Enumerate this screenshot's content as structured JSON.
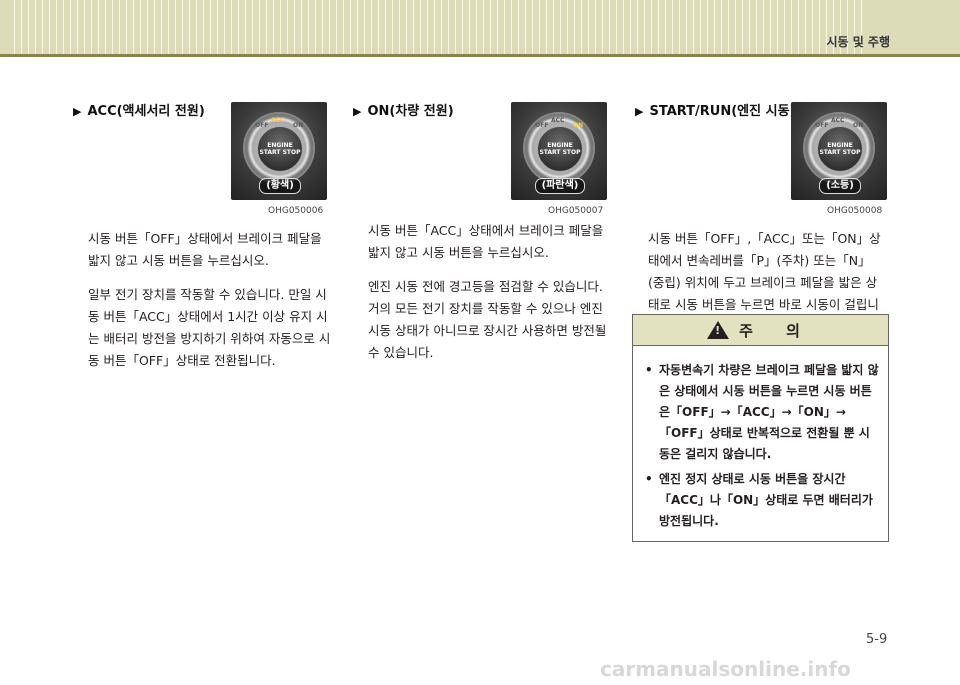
{
  "header": {
    "title": "시동 및 주행"
  },
  "sections": [
    {
      "heading": "ACC(액세서리 전원)",
      "image": {
        "button_text": "ENGINE START STOP",
        "color_tag": "(황색)",
        "code": "OHG050006",
        "lit": "ACC"
      },
      "paragraphs": [
        "시동 버튼「OFF」상태에서 브레이크 페달을 밟지 않고 시동 버튼을 누르십시오.",
        "일부 전기 장치를 작동할 수 있습니다. 만일 시동 버튼「ACC」상태에서 1시간 이상 유지 시는 배터리 방전을 방지하기 위하여 자동으로 시동 버튼「OFF」상태로 전환됩니다."
      ]
    },
    {
      "heading": "ON(차량 전원)",
      "image": {
        "button_text": "ENGINE START STOP",
        "color_tag": "(파란색)",
        "code": "OHG050007",
        "lit": "ON"
      },
      "paragraphs": [
        "시동 버튼「ACC」상태에서 브레이크 페달을 밟지 않고 시동 버튼을 누르십시오.",
        "엔진 시동 전에 경고등을 점검할 수 있습니다. 거의 모든 전기 장치를 작동할 수 있으나 엔진 시동 상태가 아니므로 장시간 사용하면 방전될 수 있습니다."
      ]
    },
    {
      "heading": "START/RUN(엔진 시동)",
      "image": {
        "button_text": "ENGINE START STOP",
        "color_tag": "(소등)",
        "code": "OHG050008",
        "lit": ""
      },
      "paragraphs": [
        "시동 버튼「OFF」,「ACC」또는「ON」상태에서 변속레버를「P」(주차) 또는「N」(중립) 위치에 두고 브레이크 페달을 밟은 상태로 시동 버튼을 누르면 바로 시동이 걸립니다."
      ]
    }
  ],
  "caution": {
    "title": "주 의",
    "items": [
      "자동변속기 차량은 브레이크 페달을 밟지 않은 상태에서 시동 버튼을 누르면 시동 버튼은「OFF」→「ACC」→「ON」→「OFF」상태로 반복적으로 전환될 뿐 시동은 걸리지 않습니다.",
      "엔진 정지 상태로 시동 버튼을 장시간「ACC」나「ON」상태로 두면 배터리가 방전됩니다."
    ]
  },
  "page_number": "5-9",
  "watermark": "carmanualsonline.info"
}
